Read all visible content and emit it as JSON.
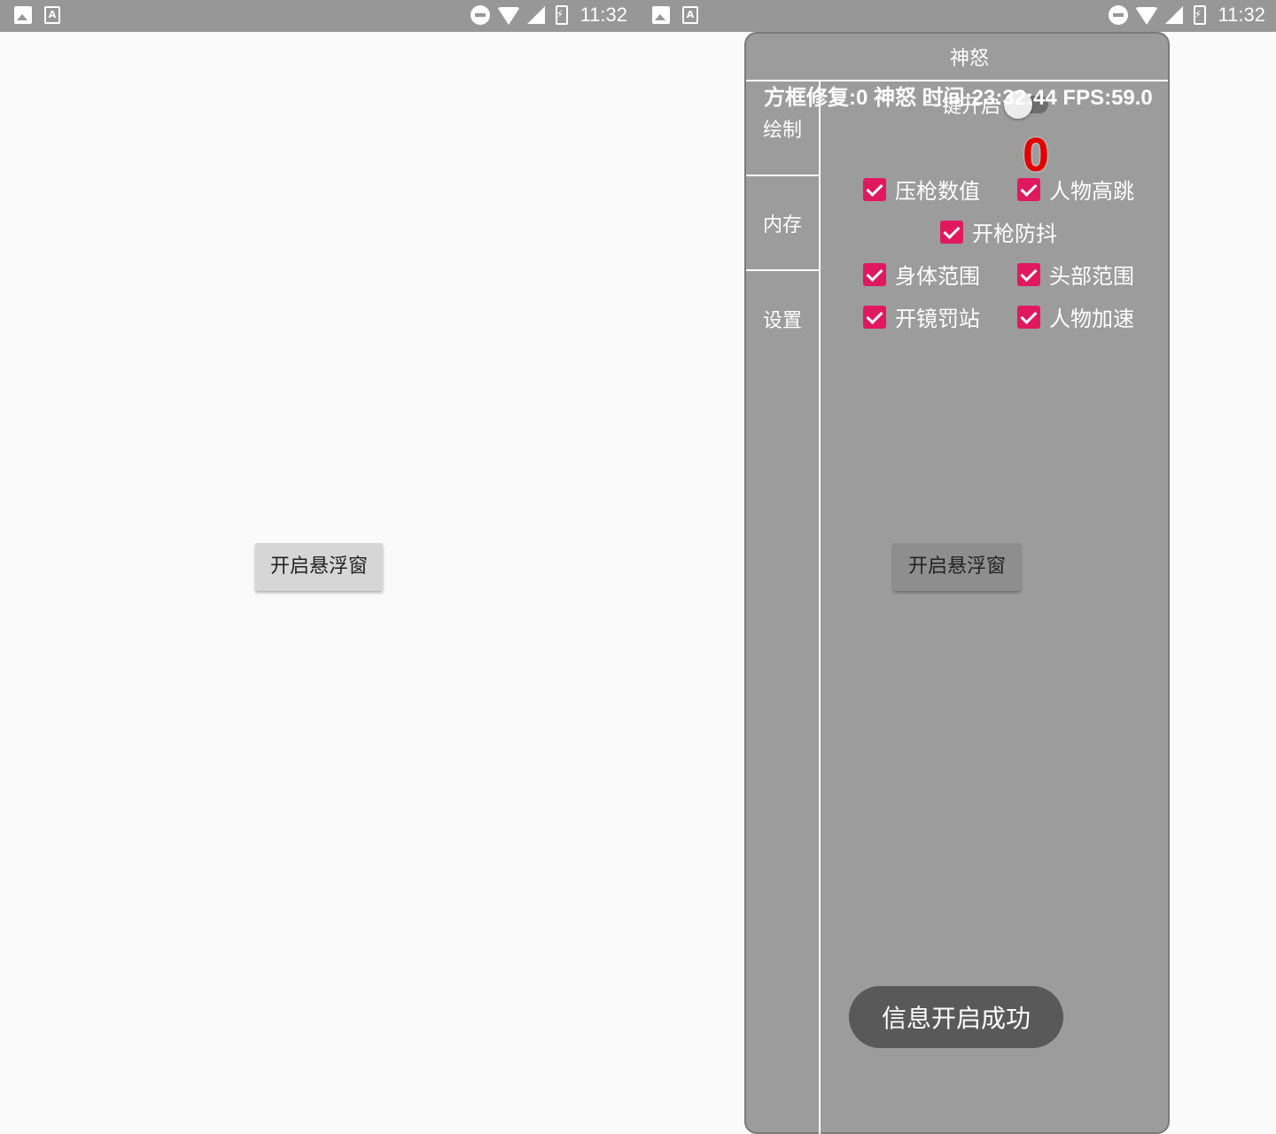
{
  "status_bar": {
    "time": "11:32",
    "notification_icons": [
      "image-icon",
      "font-a-icon"
    ],
    "system_icons": [
      "do-not-disturb-icon",
      "wifi-icon",
      "signal-icon",
      "battery-charging-icon"
    ]
  },
  "main": {
    "open_float_button": "开启悬浮窗"
  },
  "panel": {
    "overlay_info": "方框修复:0 神怒 时间:23:32:44 FPS:59.0",
    "title": "神怒",
    "tabs": [
      "绘制",
      "内存",
      "设置"
    ],
    "one_key_label": "一键开启",
    "one_key_enabled": false,
    "counter": "0",
    "options": [
      {
        "label": "压枪数值",
        "checked": true
      },
      {
        "label": "人物高跳",
        "checked": true
      },
      {
        "label": "开枪防抖",
        "checked": true
      },
      {
        "label": "身体范围",
        "checked": true
      },
      {
        "label": "头部范围",
        "checked": true
      },
      {
        "label": "开镜罚站",
        "checked": true
      },
      {
        "label": "人物加速",
        "checked": true
      }
    ]
  },
  "toast": "信息开启成功",
  "colors": {
    "status_bar": "#979797",
    "panel_bg": "#9c9c9c",
    "checkbox": "#e0195f",
    "counter": "#e00000",
    "toast_bg": "#595959"
  }
}
